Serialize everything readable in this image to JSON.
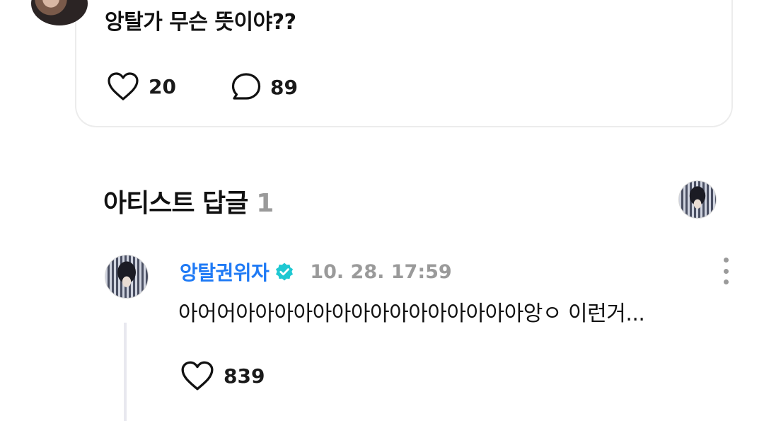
{
  "post": {
    "text": "앙탈가 무슨 뜻이야??",
    "like_count": "20",
    "comment_count": "89",
    "icons": {
      "like": "heart-outline-icon",
      "comment": "speech-bubble-icon"
    }
  },
  "artist_replies": {
    "title": "아티스트 답글",
    "count": "1",
    "reply": {
      "author": "앙탈권위자",
      "timestamp": "10. 28. 17:59",
      "text": "아어어아아아아아아아아아아아아아아아앙ㅇ 이런거...",
      "like_count": "839",
      "icons": {
        "verified": "verified-badge-icon",
        "more": "more-vertical-icon",
        "like": "heart-outline-icon"
      }
    }
  },
  "colors": {
    "author_name": "#1f7af5",
    "verified_badge": "#1ec8d2",
    "muted_text": "#9a9a9a",
    "card_border": "#ececec",
    "thread_line": "#e8e8ef"
  }
}
